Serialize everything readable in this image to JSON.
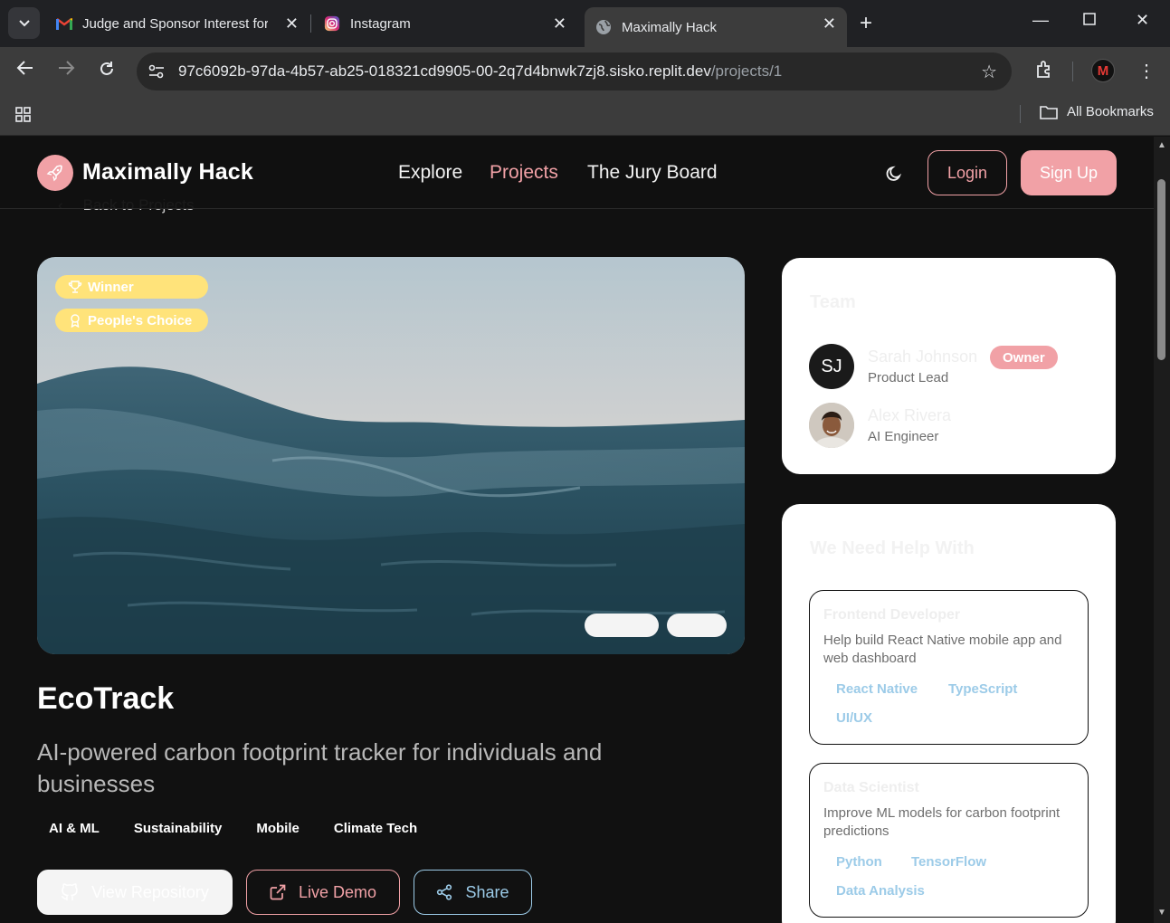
{
  "browser": {
    "tabs": [
      {
        "title": "Judge and Sponsor Interest for",
        "icon": "gmail-icon"
      },
      {
        "title": "Instagram",
        "icon": "instagram-icon"
      },
      {
        "title": "Maximally Hack",
        "icon": "globe-icon"
      }
    ],
    "url_host": "97c6092b-97da-4b57-ab25-018321cd9905-00-2q7d4bnwk7zj8.sisko.replit.dev",
    "url_path": "/projects/1",
    "bookmarks_label": "All Bookmarks"
  },
  "nav": {
    "logo": "Maximally Hack",
    "links": [
      "Explore",
      "Projects",
      "The Jury Board"
    ],
    "active_link": "Projects",
    "login": "Login",
    "signup": "Sign Up"
  },
  "back_label": "Back to Projects",
  "project": {
    "badges": [
      "Winner",
      "People's Choice"
    ],
    "title": "EcoTrack",
    "tagline": "AI-powered carbon footprint tracker for individuals and businesses",
    "tags": [
      "AI & ML",
      "Sustainability",
      "Mobile",
      "Climate Tech"
    ],
    "actions": {
      "repo": "View Repository",
      "demo": "Live Demo",
      "share": "Share"
    }
  },
  "team": {
    "title": "Team",
    "members": [
      {
        "initials": "SJ",
        "name": "Sarah Johnson",
        "role": "Product Lead",
        "badge": "Owner"
      },
      {
        "name": "Alex Rivera",
        "role": "AI Engineer"
      }
    ]
  },
  "needs": {
    "title": "We Need Help With",
    "items": [
      {
        "title": "Frontend Developer",
        "desc": "Help build React Native mobile app and web dashboard",
        "skills": [
          "React Native",
          "TypeScript",
          "UI/UX"
        ]
      },
      {
        "title": "Data Scientist",
        "desc": "Improve ML models for carbon footprint predictions",
        "skills": [
          "Python",
          "TensorFlow",
          "Data Analysis"
        ]
      }
    ]
  },
  "colors": {
    "accent": "#f1a1a6",
    "link_blue": "#9ccbe8",
    "badge_yellow": "#ffe37a"
  }
}
